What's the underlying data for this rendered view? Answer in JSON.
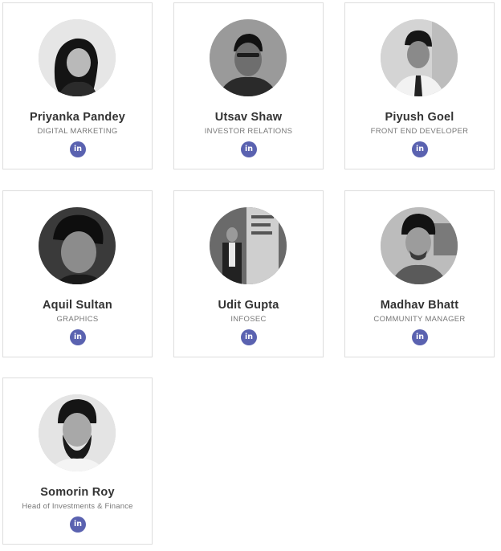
{
  "team": {
    "members": [
      {
        "name": "Priyanka Pandey",
        "role": "DIGITAL MARKETING",
        "icon": "linkedin-icon",
        "icon_text": "in"
      },
      {
        "name": "Utsav Shaw",
        "role": "INVESTOR RELATIONS",
        "icon": "linkedin-icon",
        "icon_text": "in"
      },
      {
        "name": "Piyush Goel",
        "role": "FRONT END DEVELOPER",
        "icon": "linkedin-icon",
        "icon_text": "in"
      },
      {
        "name": "Aquil Sultan",
        "role": "GRAPHICS",
        "icon": "linkedin-icon",
        "icon_text": "in"
      },
      {
        "name": "Udit Gupta",
        "role": "INFOSEC",
        "icon": "linkedin-icon",
        "icon_text": "in"
      },
      {
        "name": "Madhav Bhatt",
        "role": "COMMUNITY MANAGER",
        "icon": "linkedin-icon",
        "icon_text": "in"
      },
      {
        "name": "Somorin Roy",
        "role": "Head of Investments & Finance",
        "icon": "linkedin-icon",
        "icon_text": "in"
      }
    ]
  },
  "colors": {
    "linkedin_button": "#5a62b0",
    "card_border": "#dddddd",
    "name_text": "#333333",
    "role_text": "#777777"
  }
}
